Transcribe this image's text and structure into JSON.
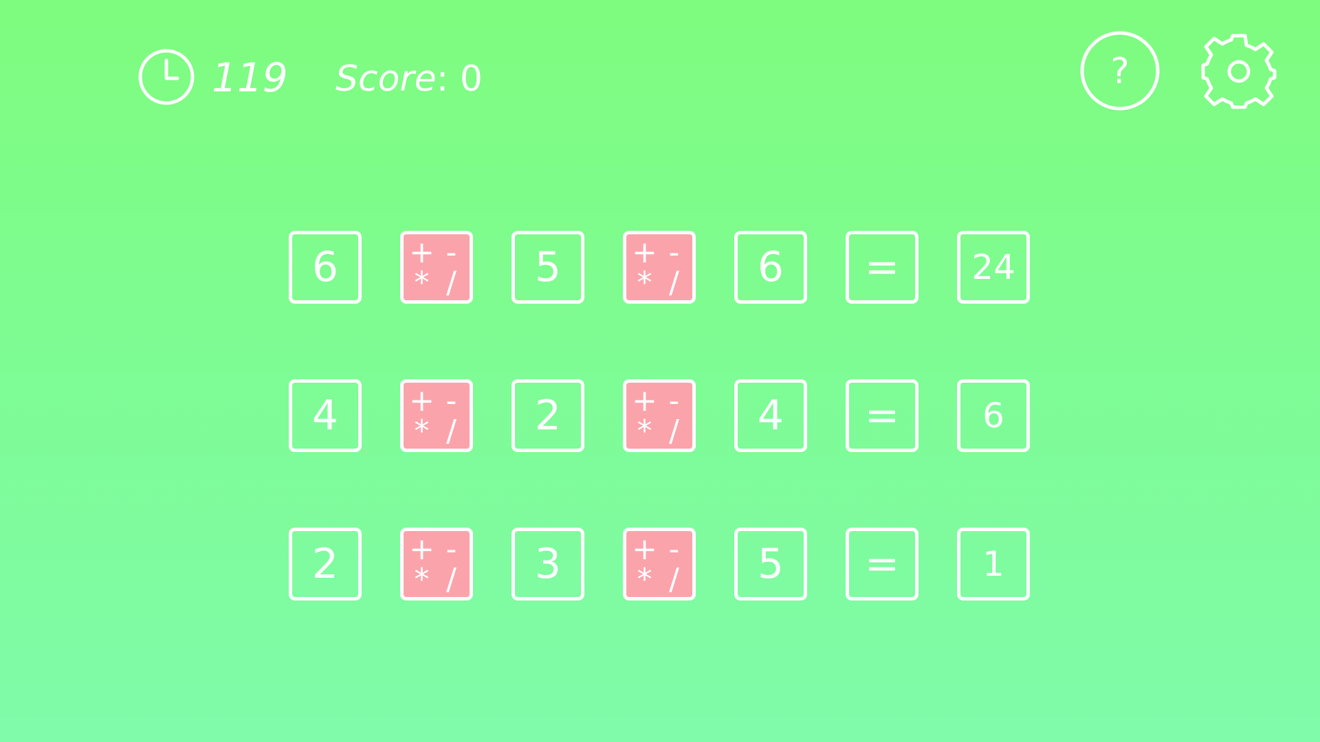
{
  "hud": {
    "timer_icon": "clock-icon",
    "timer_value": "119",
    "score_label": "Score",
    "score_separator": ":",
    "score_value": "0",
    "help_icon": "question-mark-icon",
    "help_label": "?",
    "settings_icon": "gear-icon"
  },
  "colors": {
    "background_top": "#7efc7f",
    "background_bottom": "#7ffbaa",
    "tile_border": "#ffffff",
    "operator_tile_fill": "#fba3ab"
  },
  "operators": {
    "plus": "+",
    "minus": "-",
    "multiply": "*",
    "divide": "/"
  },
  "equations": [
    {
      "a": "6",
      "b": "5",
      "c": "6",
      "equals": "=",
      "result": "24"
    },
    {
      "a": "4",
      "b": "2",
      "c": "4",
      "equals": "=",
      "result": "6"
    },
    {
      "a": "2",
      "b": "3",
      "c": "5",
      "equals": "=",
      "result": "1"
    }
  ]
}
